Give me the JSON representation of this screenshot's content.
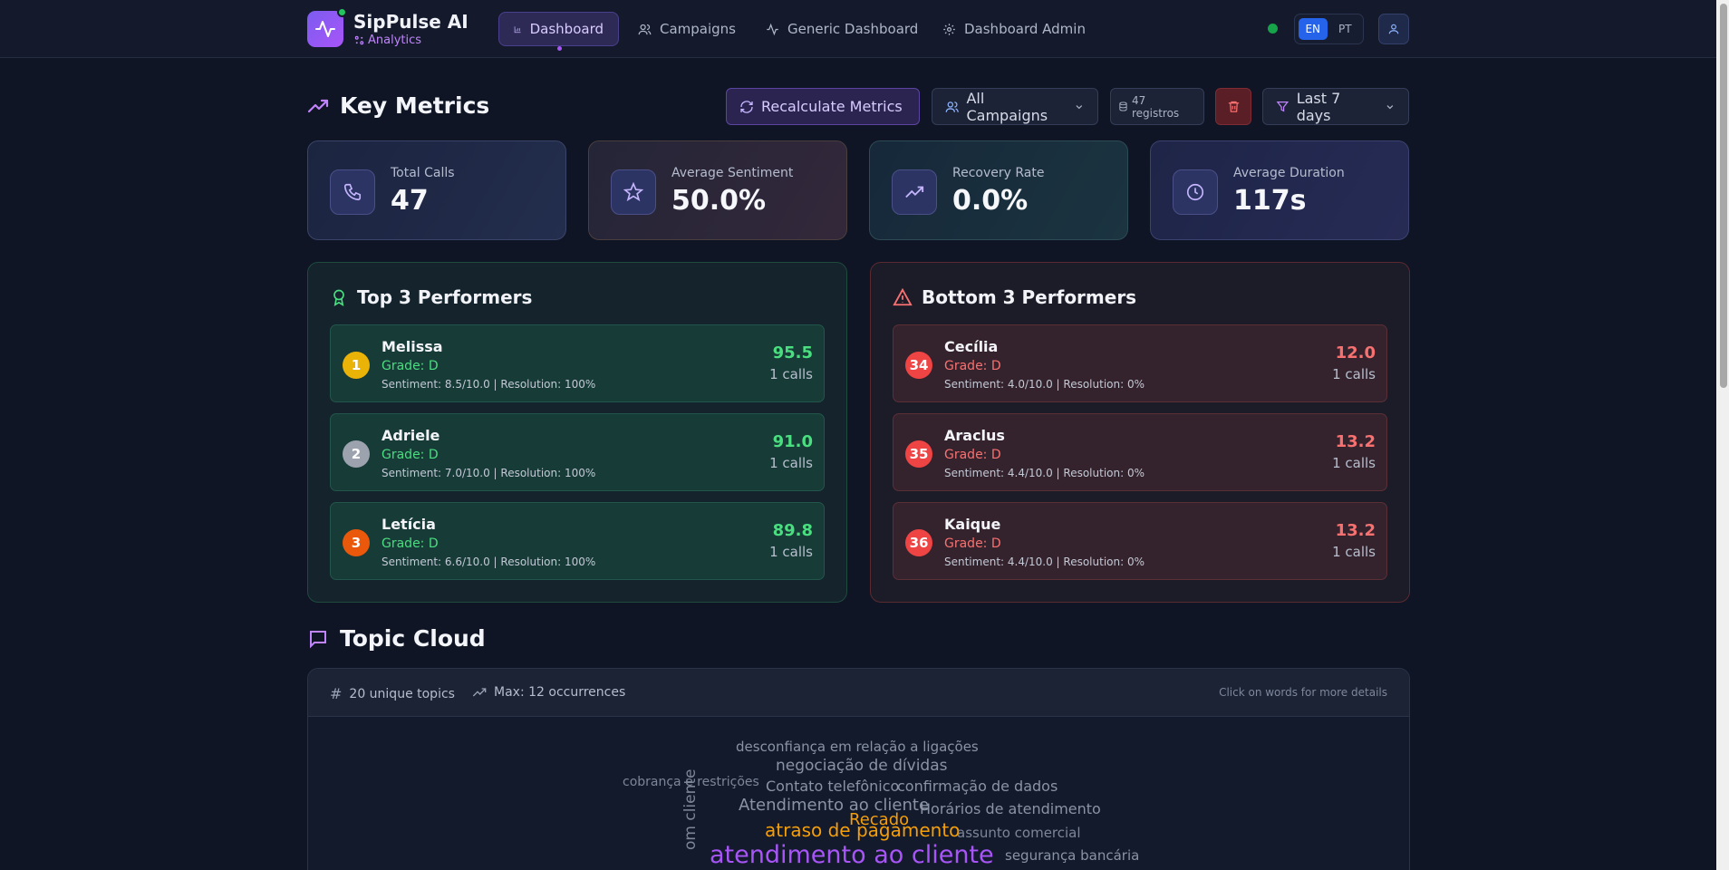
{
  "brand": {
    "name": "SipPulse AI",
    "subtitle": "Analytics"
  },
  "nav": {
    "items": [
      {
        "label": "Dashboard",
        "icon": "bar-chart-icon",
        "active": true
      },
      {
        "label": "Campaigns",
        "icon": "users-icon"
      },
      {
        "label": "Generic Dashboard",
        "icon": "activity-icon"
      },
      {
        "label": "Dashboard Admin",
        "icon": "gear-icon"
      }
    ],
    "languages": [
      "EN",
      "PT"
    ],
    "active_language": "EN"
  },
  "key_metrics": {
    "title": "Key Metrics",
    "recalc_label": "Recalculate Metrics",
    "campaign_filter": "All Campaigns",
    "records_label": "47 registros",
    "period_filter": "Last 7 days",
    "cards": [
      {
        "label": "Total Calls",
        "value": "47",
        "icon": "phone-icon"
      },
      {
        "label": "Average Sentiment",
        "value": "50.0%",
        "icon": "star-icon"
      },
      {
        "label": "Recovery Rate",
        "value": "0.0%",
        "icon": "trending-up-icon"
      },
      {
        "label": "Average Duration",
        "value": "117s",
        "icon": "clock-icon"
      }
    ]
  },
  "top_performers": {
    "title": "Top 3 Performers",
    "rows": [
      {
        "rank": "1",
        "name": "Melissa",
        "grade": "Grade: D",
        "detail": "Sentiment: 8.5/10.0 | Resolution: 100%",
        "score": "95.5",
        "calls": "1 calls",
        "badge_color": "#eab308"
      },
      {
        "rank": "2",
        "name": "Adriele",
        "grade": "Grade: D",
        "detail": "Sentiment: 7.0/10.0 | Resolution: 100%",
        "score": "91.0",
        "calls": "1 calls",
        "badge_color": "#9ca3af"
      },
      {
        "rank": "3",
        "name": "Letícia",
        "grade": "Grade: D",
        "detail": "Sentiment: 6.6/10.0 | Resolution: 100%",
        "score": "89.8",
        "calls": "1 calls",
        "badge_color": "#ea580c"
      }
    ]
  },
  "bottom_performers": {
    "title": "Bottom 3 Performers",
    "rows": [
      {
        "rank": "34",
        "name": "Cecília",
        "grade": "Grade: D",
        "detail": "Sentiment: 4.0/10.0 | Resolution: 0%",
        "score": "12.0",
        "calls": "1 calls",
        "badge_color": "#ef4444"
      },
      {
        "rank": "35",
        "name": "Araclus",
        "grade": "Grade: D",
        "detail": "Sentiment: 4.4/10.0 | Resolution: 0%",
        "score": "13.2",
        "calls": "1 calls",
        "badge_color": "#ef4444"
      },
      {
        "rank": "36",
        "name": "Kaique",
        "grade": "Grade: D",
        "detail": "Sentiment: 4.4/10.0 | Resolution: 0%",
        "score": "13.2",
        "calls": "1 calls",
        "badge_color": "#ef4444"
      }
    ]
  },
  "topic_cloud": {
    "title": "Topic Cloud",
    "unique_topics": "20 unique topics",
    "max_occurrences": "Max: 12 occurrences",
    "hint": "Click on words for more details",
    "words": [
      {
        "text": "desconfiança em relação a ligações",
        "color": "#8a93a5"
      },
      {
        "text": "negociação de dívidas",
        "color": "#8a93a5"
      },
      {
        "text": "cobrança e restrições",
        "color": "#7d8699"
      },
      {
        "text": "Contato telefônico",
        "color": "#8a93a5"
      },
      {
        "text": "confirmação de dados",
        "color": "#8a93a5"
      },
      {
        "text": "Atendimento ao cliente",
        "color": "#8a93a5"
      },
      {
        "text": "Horários de atendimento",
        "color": "#8a93a5"
      },
      {
        "text": "Recado",
        "color": "#f59e0b"
      },
      {
        "text": "atraso de pagamento",
        "color": "#f59e0b"
      },
      {
        "text": "assunto comercial",
        "color": "#7d8699"
      },
      {
        "text": "atendimento ao cliente",
        "color": "#a855f7"
      },
      {
        "text": "segurança bancária",
        "color": "#8a93a5"
      },
      {
        "text": "om cliente",
        "color": "#7d8699"
      }
    ]
  }
}
